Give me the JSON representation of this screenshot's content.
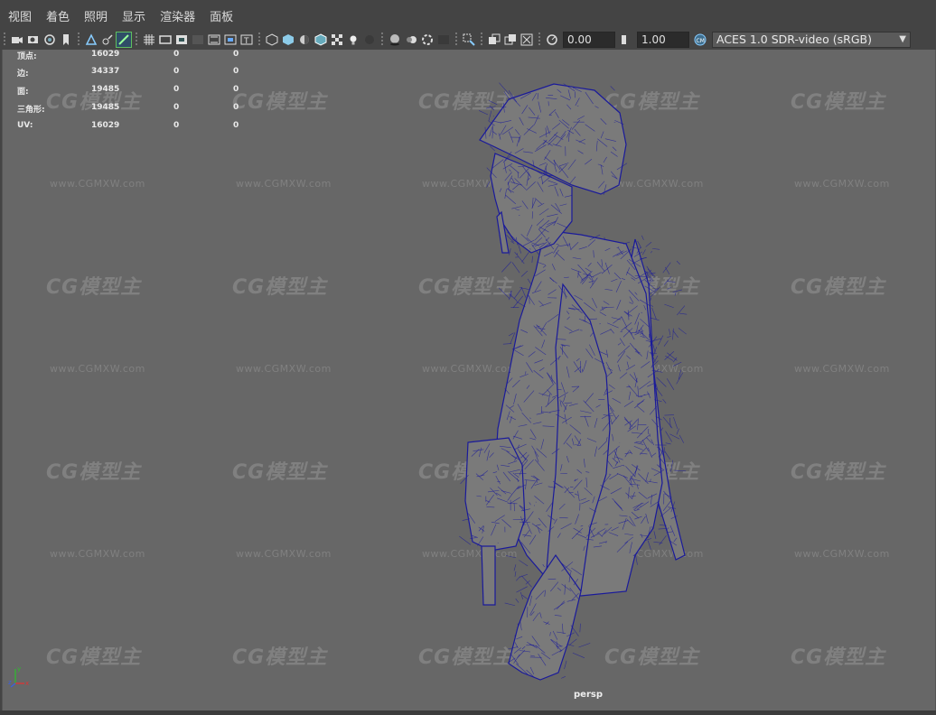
{
  "menu": {
    "items": [
      "视图",
      "着色",
      "照明",
      "显示",
      "渲染器",
      "面板"
    ]
  },
  "toolbar": {
    "exposure_value": "0.00",
    "gamma_value": "1.00",
    "color_management": "ACES 1.0 SDR-video (sRGB)",
    "icons": [
      "camera-select-icon",
      "camera-attributes-icon",
      "bookmark-icon",
      "image-plane-icon",
      "grid-icon",
      "film-gate-icon",
      "resolution-gate-icon",
      "gate-mask-icon",
      "field-chart-icon",
      "safe-action-icon",
      "safe-title-icon",
      "wireframe-icon",
      "smooth-shade-icon",
      "default-material-icon",
      "wireframe-on-shaded-icon",
      "textured-icon",
      "use-lights-icon",
      "shadows-icon",
      "screen-space-ao-icon",
      "motion-blur-icon",
      "anti-aliasing-icon",
      "depth-of-field-icon",
      "isolate-select-icon",
      "xray-icon",
      "xray-joints-icon",
      "backface-culling-icon",
      "exposure-icon",
      "gamma-icon",
      "color-management-icon"
    ]
  },
  "hud": {
    "rows": [
      {
        "label": "顶点:",
        "v1": "16029",
        "v2": "0",
        "v3": "0"
      },
      {
        "label": "边:",
        "v1": "34337",
        "v2": "0",
        "v3": "0"
      },
      {
        "label": "面:",
        "v1": "19485",
        "v2": "0",
        "v3": "0"
      },
      {
        "label": "三角形:",
        "v1": "19485",
        "v2": "0",
        "v3": "0"
      },
      {
        "label": "UV:",
        "v1": "16029",
        "v2": "0",
        "v3": "0"
      }
    ]
  },
  "viewport": {
    "camera": "persp",
    "background_color": "#676767",
    "wireframe_color": "#1a1a9a",
    "mesh_color": "#7a7a7a"
  },
  "watermark": {
    "logo": "CG模型主",
    "url": "www.CGMXW.com"
  },
  "axis": {
    "x": "x",
    "y": "y",
    "z": "z"
  }
}
